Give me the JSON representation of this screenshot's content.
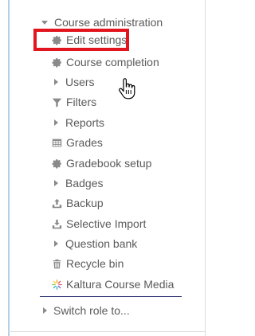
{
  "menu": {
    "header": "Course administration",
    "items": [
      {
        "label": "Edit settings",
        "icon": "gear-icon"
      },
      {
        "label": "Course completion",
        "icon": "gear-icon"
      },
      {
        "label": "Users",
        "icon": "chevron-right-icon"
      },
      {
        "label": "Filters",
        "icon": "filter-icon"
      },
      {
        "label": "Reports",
        "icon": "chevron-right-icon"
      },
      {
        "label": "Grades",
        "icon": "table-icon"
      },
      {
        "label": "Gradebook setup",
        "icon": "gear-icon"
      },
      {
        "label": "Badges",
        "icon": "chevron-right-icon"
      },
      {
        "label": "Backup",
        "icon": "upload-icon"
      },
      {
        "label": "Selective Import",
        "icon": "download-icon"
      },
      {
        "label": "Question bank",
        "icon": "chevron-right-icon"
      },
      {
        "label": "Recycle bin",
        "icon": "trash-icon"
      },
      {
        "label": "Kaltura Course Media",
        "icon": "kaltura-logo-icon"
      }
    ],
    "footer": "Switch role to..."
  },
  "colors": {
    "text": "#5a5a5a",
    "icon": "#8a8a8a",
    "highlight": "#e2141d",
    "divider": "#2b2e6f",
    "left_rule": "#b4cfe8"
  }
}
